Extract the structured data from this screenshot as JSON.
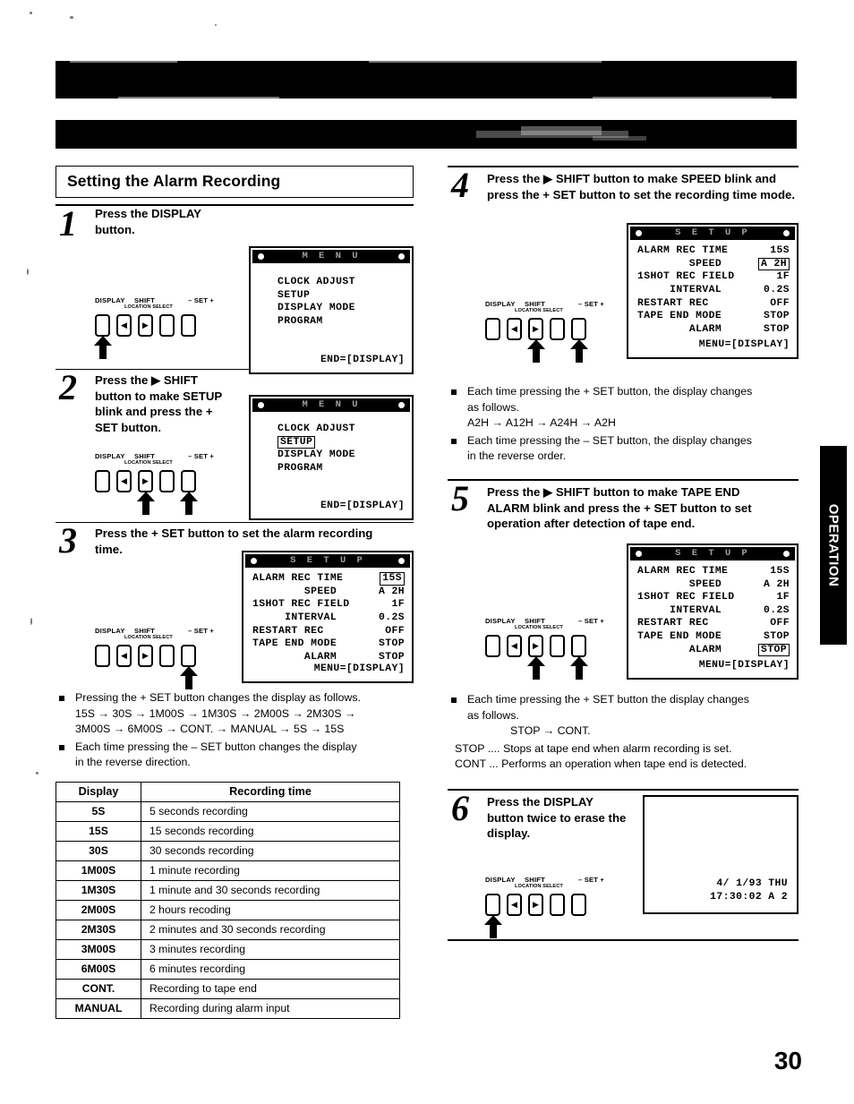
{
  "page": {
    "number": "30",
    "side_tab_label": "OPERATION",
    "heading": "Setting the Alarm Recording"
  },
  "button_panel": {
    "display_label": "DISPLAY",
    "shift_label": "SHIFT",
    "location_select_label": "LOCATION SELECT",
    "set_label": "– SET +",
    "left_arrow_glyph": "◀",
    "right_arrow_glyph": "▶"
  },
  "steps": [
    {
      "number": "1",
      "text_line1": "Press the DISPLAY",
      "text_line2": "button."
    },
    {
      "number": "2",
      "text_line1": "Press the ▶  SHIFT",
      "text_line2": "button to make SETUP",
      "text_line3": "blink and press the +",
      "text_line4": "SET button."
    },
    {
      "number": "3",
      "text_line1": "Press the + SET button to set the alarm recording",
      "text_line2": "time."
    },
    {
      "number": "4",
      "text_line1": "Press the ▶  SHIFT button to make SPEED blink and",
      "text_line2": "press the + SET button to set the recording time mode."
    },
    {
      "number": "5",
      "text_line1": "Press the ▶  SHIFT button to make TAPE END",
      "text_line2": "ALARM blink and press the + SET button to set",
      "text_line3": "operation after detection of tape end."
    },
    {
      "number": "6",
      "text_line1": "Press the DISPLAY",
      "text_line2": "button twice to erase the",
      "text_line3": "display."
    }
  ],
  "osd_menu": {
    "title": "M E N U",
    "items": [
      "CLOCK ADJUST",
      "SETUP",
      "DISPLAY MODE",
      "PROGRAM"
    ],
    "footer": "END=[DISPLAY]",
    "highlighted_item": "SETUP"
  },
  "osd_setup": {
    "title": "S E T U P",
    "rows": [
      {
        "label": "ALARM REC TIME",
        "value": "15S"
      },
      {
        "label": "        SPEED",
        "value": "A 2H"
      },
      {
        "label": "1SHOT REC FIELD",
        "value": "1F"
      },
      {
        "label": "     INTERVAL",
        "value": "0.2S"
      },
      {
        "label": "RESTART REC",
        "value": "OFF"
      },
      {
        "label": "TAPE END MODE",
        "value": "STOP"
      },
      {
        "label": "        ALARM",
        "value": "STOP"
      }
    ],
    "footer": "MENU=[DISPLAY]",
    "highlight_step3": "ALARM REC TIME",
    "highlight_step4": "SPEED",
    "highlight_step5": "ALARM"
  },
  "osd_timestamp": {
    "date": "4/ 1/93 THU",
    "time": "17:30:02 A 2"
  },
  "notes_step3": {
    "bullet1_line1": "Pressing the + SET button changes the display as follows.",
    "bullet1_line2": "15S → 30S → 1M00S → 1M30S → 2M00S → 2M30S →",
    "bullet1_line3": "3M00S → 6M00S → CONT. → MANUAL → 5S → 15S",
    "bullet2_line1": "Each time pressing the – SET button changes the display",
    "bullet2_line2": "in the reverse direction."
  },
  "notes_step4": {
    "bullet1_line1": "Each time pressing the + SET button, the display changes",
    "bullet1_line2": "as follows.",
    "bullet1_line3": "A2H → A12H → A24H → A2H",
    "bullet2_line1": "Each time pressing the – SET button, the display changes",
    "bullet2_line2": "in the reverse order."
  },
  "notes_step5": {
    "bullet1_line1": "Each time pressing the + SET button the display changes",
    "bullet1_line2": "as follows.",
    "bullet1_line3": "STOP → CONT.",
    "line_stop": "STOP .... Stops at tape end when alarm recording is set.",
    "line_cont": "CONT ... Performs an operation when tape end is detected."
  },
  "table_recording_time": {
    "headers": [
      "Display",
      "Recording time"
    ],
    "rows": [
      [
        "5S",
        "5 seconds recording"
      ],
      [
        "15S",
        "15 seconds recording"
      ],
      [
        "30S",
        "30 seconds recording"
      ],
      [
        "1M00S",
        "1 minute recording"
      ],
      [
        "1M30S",
        "1 minute and 30 seconds recording"
      ],
      [
        "2M00S",
        "2 hours recoding"
      ],
      [
        "2M30S",
        "2 minutes and 30 seconds recording"
      ],
      [
        "3M00S",
        "3 minutes recording"
      ],
      [
        "6M00S",
        "6 minutes recording"
      ],
      [
        "CONT.",
        "Recording to tape end"
      ],
      [
        "MANUAL",
        "Recording during alarm input"
      ]
    ]
  }
}
